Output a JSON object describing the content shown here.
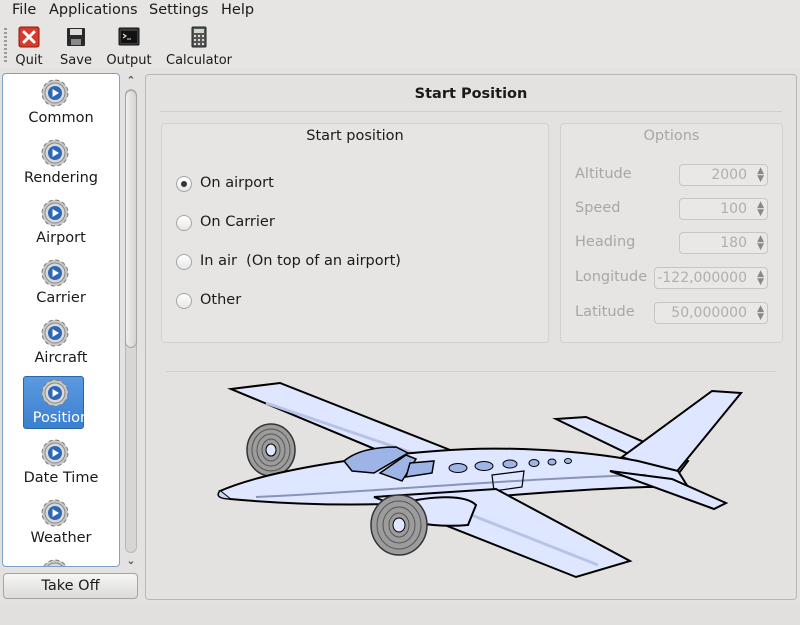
{
  "menu": {
    "file": "File",
    "applications": "Applications",
    "settings": "Settings",
    "help": "Help"
  },
  "toolbar": {
    "quit": "Quit",
    "save": "Save",
    "output": "Output",
    "calculator": "Calculator"
  },
  "sidebar": {
    "items": [
      {
        "label": "Common"
      },
      {
        "label": "Rendering"
      },
      {
        "label": "Airport"
      },
      {
        "label": "Carrier"
      },
      {
        "label": "Aircraft"
      },
      {
        "label": "Position"
      },
      {
        "label": "Date Time"
      },
      {
        "label": "Weather"
      }
    ],
    "selected": "Position"
  },
  "takeoff_button": "Take Off",
  "page": {
    "title": "Start Position",
    "start_position": {
      "title": "Start position",
      "options": [
        "On airport",
        "On Carrier",
        "In air  (On top of an airport)",
        "Other"
      ],
      "selected": "On airport"
    },
    "options_group": {
      "title": "Options",
      "fields": [
        {
          "label": "Altitude",
          "value": "2000"
        },
        {
          "label": "Speed",
          "value": "100"
        },
        {
          "label": "Heading",
          "value": "180"
        },
        {
          "label": "Longitude",
          "value": "-122,000000"
        },
        {
          "label": "Latitude",
          "value": "50,000000"
        }
      ]
    }
  },
  "colors": {
    "selection": "#3b7fd0",
    "plane_fill": "#dfe6ff",
    "window_fill": "#9fb4e6"
  }
}
